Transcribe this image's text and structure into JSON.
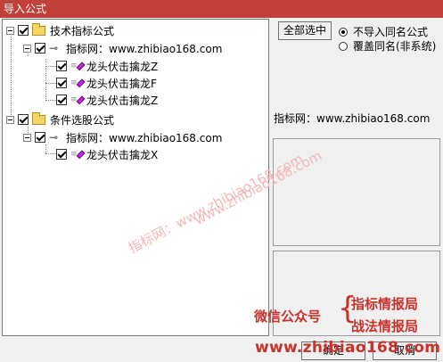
{
  "window": {
    "title": "导入公式"
  },
  "tree": {
    "groups": [
      {
        "label": "技术指标公式",
        "source": "指标网：www.zhibiao168.com",
        "items": [
          "龙头伏击擒龙Z",
          "龙头伏击擒龙F",
          "龙头伏击擒龙Z"
        ]
      },
      {
        "label": "条件选股公式",
        "source": "指标网：www.zhibiao168.com",
        "items": [
          "龙头伏击擒龙X"
        ]
      }
    ]
  },
  "right_panel": {
    "select_all_label": "全部选中",
    "radio_options": [
      {
        "label": "不导入同名公式",
        "checked": true
      },
      {
        "label": "覆盖同名(非系统)",
        "checked": false
      }
    ],
    "info_text": "指标网：www.zhibiao168.com"
  },
  "footer": {
    "ok_label": "确定",
    "cancel_label": "取消"
  },
  "overlay": {
    "watermark_domain": "www.zhibiao168.com",
    "watermark_text": "指标网：www.zhibiao168.com",
    "promo_wechat": "微信公众号",
    "promo_line1": "指标情报局",
    "promo_line2": "战法情报局",
    "promo_url": "www.zhibiao168.com"
  },
  "colors": {
    "titlebar": "#c1403a",
    "diamond": "#c42bd8",
    "promo": "#c9322a",
    "watermark": "#f3b7b7"
  }
}
